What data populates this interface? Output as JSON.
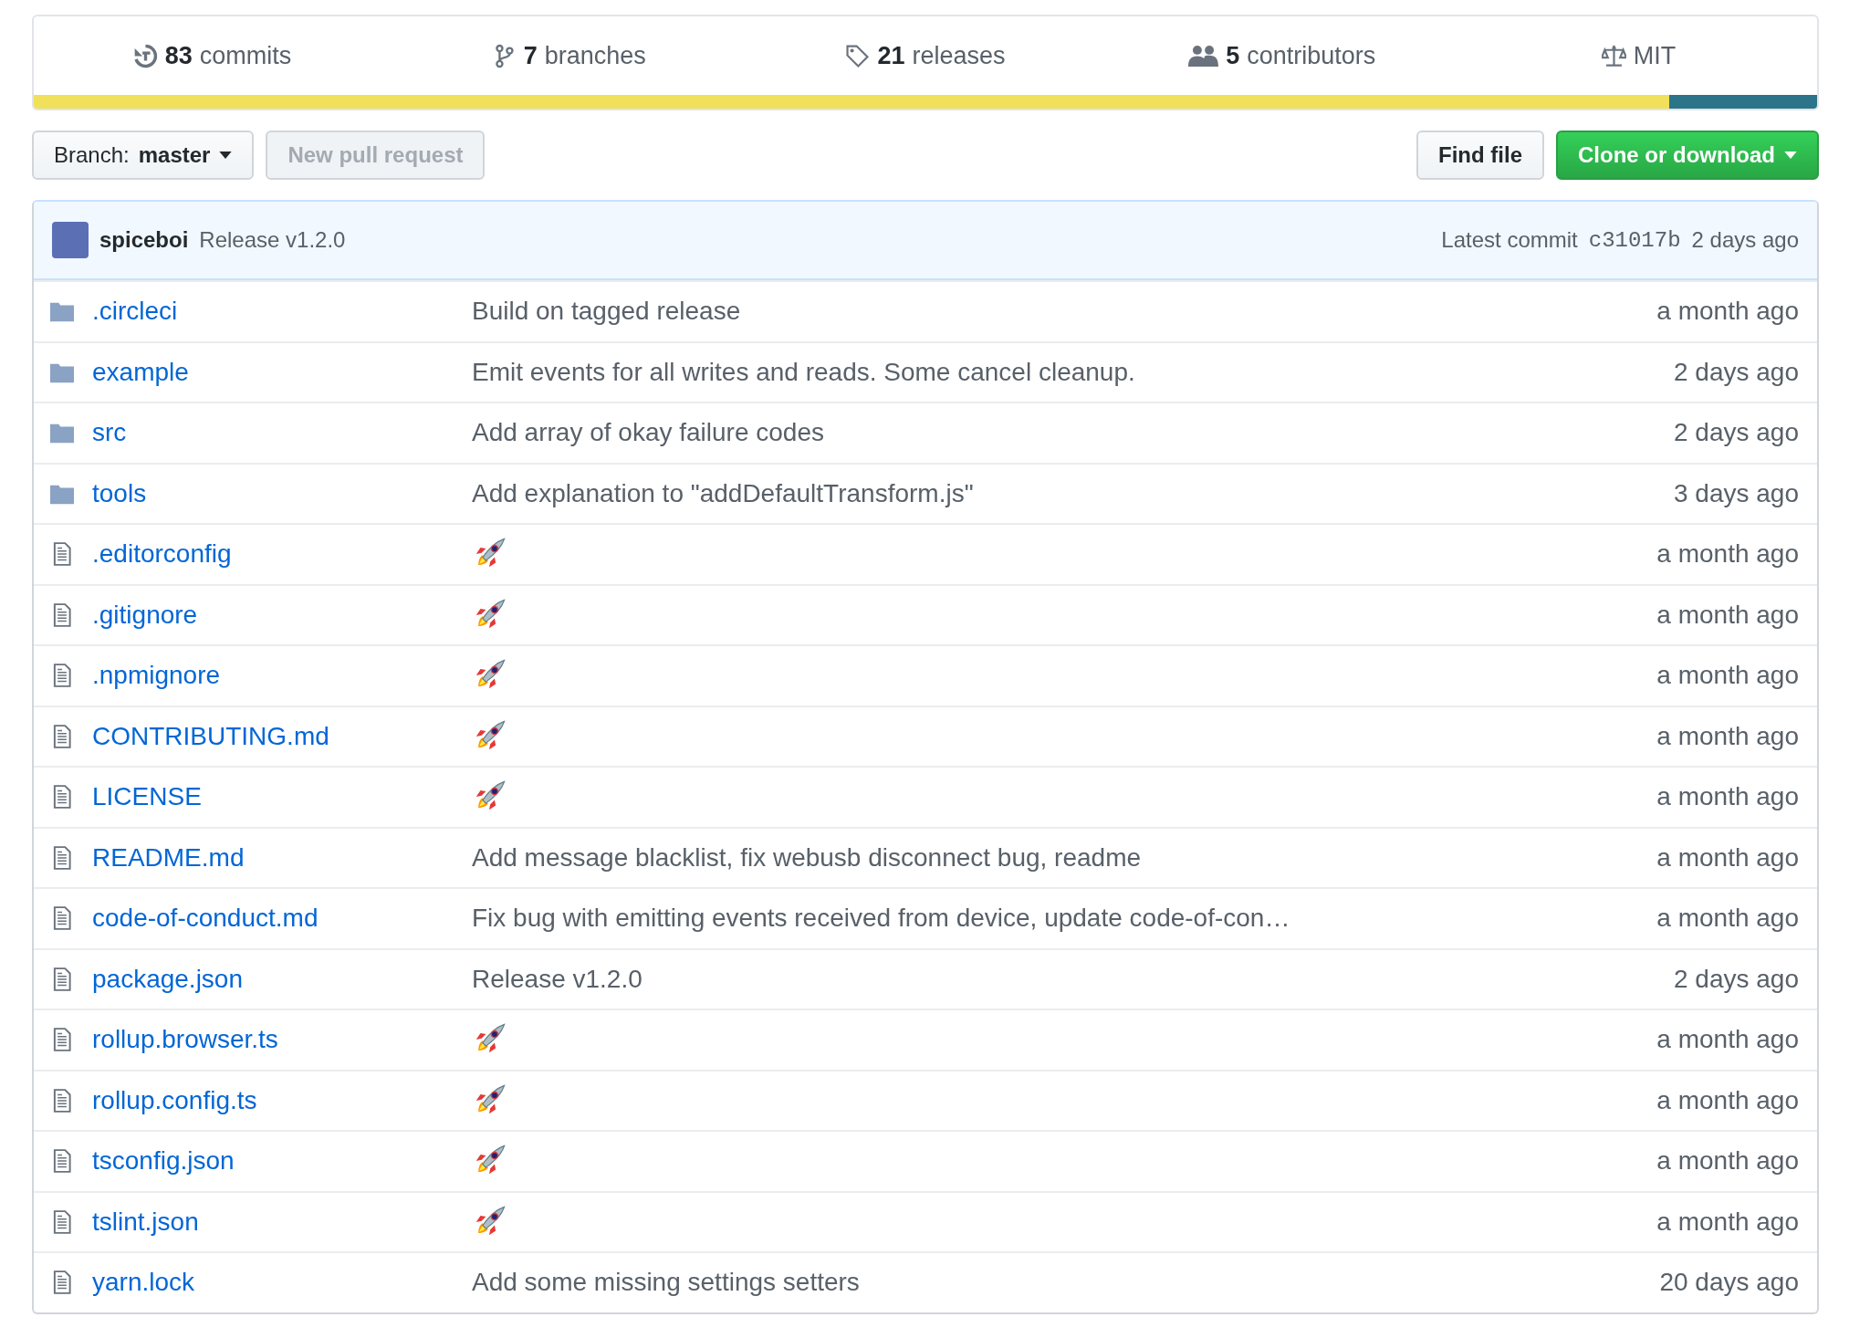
{
  "summary": {
    "stats": [
      {
        "kind": "commits",
        "count": "83",
        "label": "commits"
      },
      {
        "kind": "branches",
        "count": "7",
        "label": "branches"
      },
      {
        "kind": "releases",
        "count": "21",
        "label": "releases"
      },
      {
        "kind": "contributors",
        "count": "5",
        "label": "contributors"
      },
      {
        "kind": "license",
        "label": "MIT"
      }
    ],
    "languages": [
      {
        "color": "#f1e05a",
        "level": 0.917
      },
      {
        "color": "#2b7489",
        "level": 0.083
      }
    ]
  },
  "toolbar": {
    "branch_label": "Branch:",
    "branch": "master",
    "new_pr": {
      "label": "New pull request",
      "disabled": true
    },
    "find_file": "Find file",
    "clone": "Clone or download"
  },
  "latest_commit": {
    "author": "spiceboi",
    "message": "Release v1.2.0",
    "prefix": "Latest commit",
    "sha": "c31017b",
    "age": "2 days ago"
  },
  "files": [
    {
      "kind": "dir",
      "name": ".circleci",
      "message": {
        "kind": "text",
        "text": "Build on tagged release"
      },
      "age": "a month ago"
    },
    {
      "kind": "dir",
      "name": "example",
      "message": {
        "kind": "text",
        "text": "Emit events for all writes and reads. Some cancel cleanup."
      },
      "age": "2 days ago"
    },
    {
      "kind": "dir",
      "name": "src",
      "message": {
        "kind": "text",
        "text": "Add array of okay failure codes"
      },
      "age": "2 days ago"
    },
    {
      "kind": "dir",
      "name": "tools",
      "message": {
        "kind": "text",
        "text": "Add explanation to \"addDefaultTransform.js\""
      },
      "age": "3 days ago"
    },
    {
      "kind": "file",
      "name": ".editorconfig",
      "message": {
        "kind": "rocket"
      },
      "age": "a month ago"
    },
    {
      "kind": "file",
      "name": ".gitignore",
      "message": {
        "kind": "rocket"
      },
      "age": "a month ago"
    },
    {
      "kind": "file",
      "name": ".npmignore",
      "message": {
        "kind": "rocket"
      },
      "age": "a month ago"
    },
    {
      "kind": "file",
      "name": "CONTRIBUTING.md",
      "message": {
        "kind": "rocket"
      },
      "age": "a month ago"
    },
    {
      "kind": "file",
      "name": "LICENSE",
      "message": {
        "kind": "rocket"
      },
      "age": "a month ago"
    },
    {
      "kind": "file",
      "name": "README.md",
      "message": {
        "kind": "text",
        "text": "Add message blacklist, fix webusb disconnect bug, readme"
      },
      "age": "a month ago"
    },
    {
      "kind": "file",
      "name": "code-of-conduct.md",
      "message": {
        "kind": "text",
        "text": "Fix bug with emitting events received from device, update code-of-con…"
      },
      "age": "a month ago"
    },
    {
      "kind": "file",
      "name": "package.json",
      "message": {
        "kind": "text",
        "text": "Release v1.2.0"
      },
      "age": "2 days ago"
    },
    {
      "kind": "file",
      "name": "rollup.browser.ts",
      "message": {
        "kind": "rocket"
      },
      "age": "a month ago"
    },
    {
      "kind": "file",
      "name": "rollup.config.ts",
      "message": {
        "kind": "rocket"
      },
      "age": "a month ago"
    },
    {
      "kind": "file",
      "name": "tsconfig.json",
      "message": {
        "kind": "rocket"
      },
      "age": "a month ago"
    },
    {
      "kind": "file",
      "name": "tslint.json",
      "message": {
        "kind": "rocket"
      },
      "age": "a month ago"
    },
    {
      "kind": "file",
      "name": "yarn.lock",
      "message": {
        "kind": "text",
        "text": "Add some missing settings setters"
      },
      "age": "20 days ago"
    }
  ]
}
